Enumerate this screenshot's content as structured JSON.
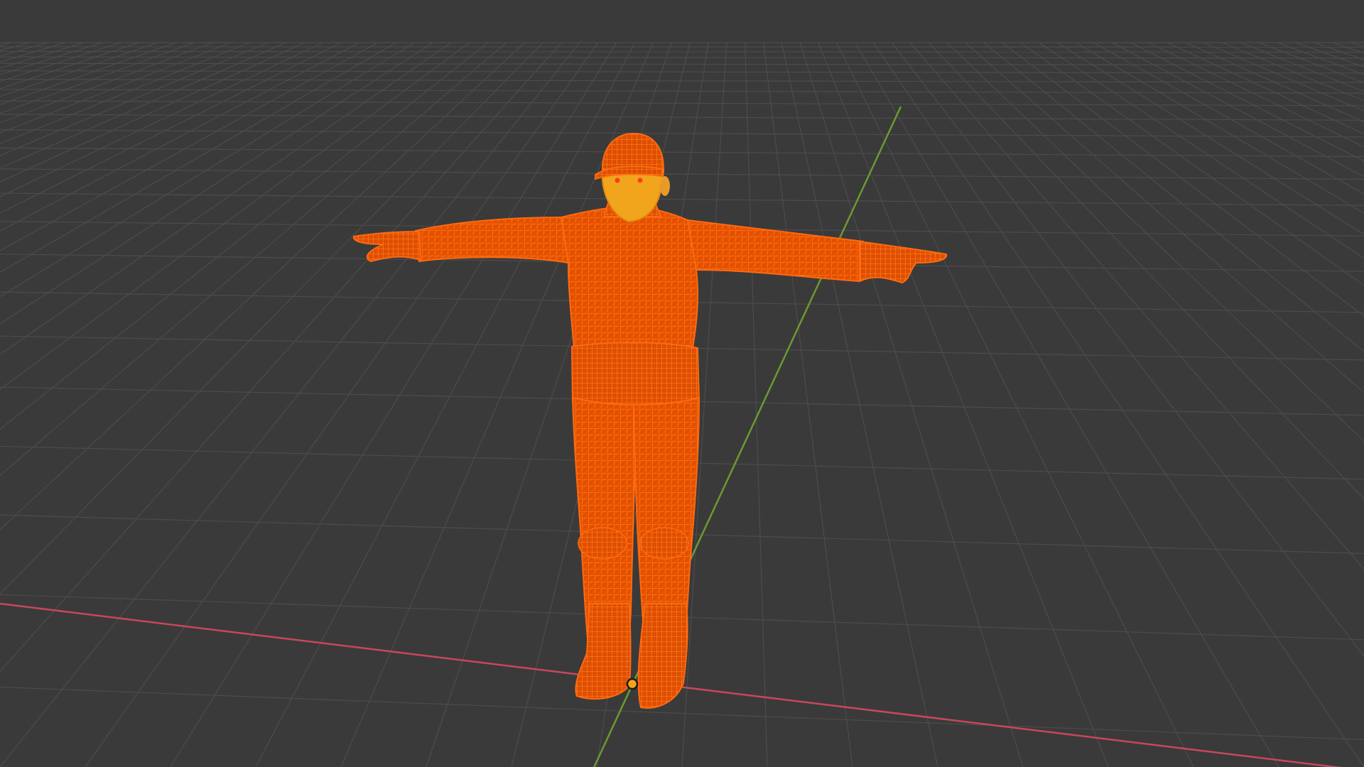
{
  "viewport": {
    "background_color": "#3a3a3a",
    "grid_color": "#4c4c4c",
    "x_axis_color": "#c8475d",
    "y_axis_color": "#6b9a2f"
  },
  "selected_object": {
    "display": "wireframe",
    "wire_color": "#ff5a00",
    "wire_color_dark": "#e04a00",
    "active_face_color": "#f0a51c",
    "origin_color": "#f7a21b",
    "icon": "origin-dot-icon"
  }
}
